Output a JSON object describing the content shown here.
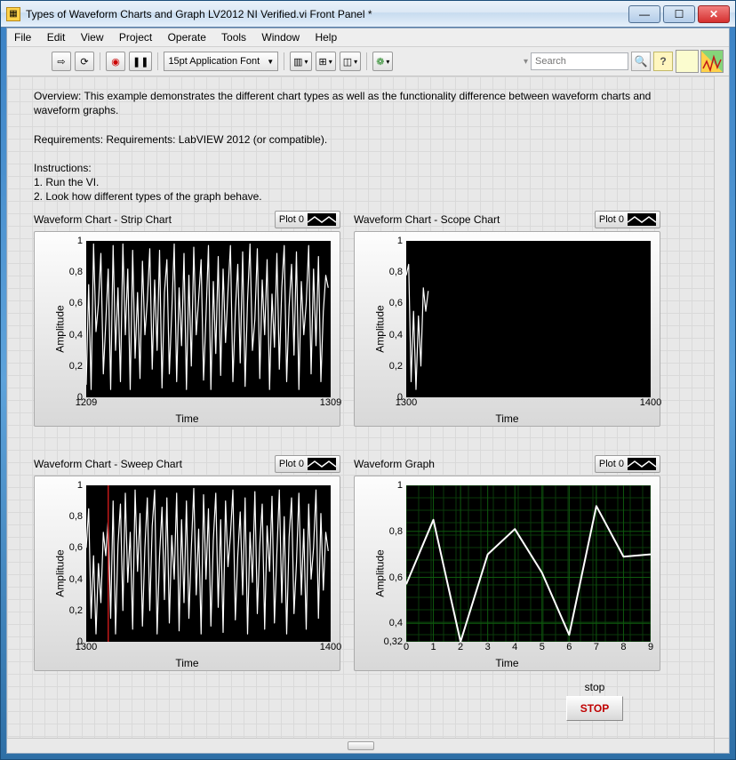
{
  "window": {
    "title": "Types of Waveform Charts and Graph LV2012 NI Verified.vi Front Panel *"
  },
  "menu": {
    "items": [
      "File",
      "Edit",
      "View",
      "Project",
      "Operate",
      "Tools",
      "Window",
      "Help"
    ]
  },
  "toolbar": {
    "font": "15pt Application Font",
    "search_placeholder": "Search"
  },
  "description": {
    "overview": "Overview: This example demonstrates the different chart types as well as the functionality difference between waveform charts and waveform graphs.",
    "requirements": "Requirements: Requirements: LabVIEW 2012 (or compatible).",
    "instructions_header": "Instructions:",
    "instruction1": "1. Run the VI.",
    "instruction2": "2. Look how different types of the graph behave."
  },
  "stop": {
    "label": "stop",
    "button": "STOP"
  },
  "chart_data": [
    {
      "id": "strip",
      "title": "Waveform Chart - Strip Chart",
      "legend": "Plot 0",
      "type": "line",
      "xlabel": "Time",
      "ylabel": "Amplitude",
      "yticks": [
        0,
        0.2,
        0.4,
        0.6,
        0.8,
        1
      ],
      "ytick_labels": [
        "0",
        "0,2",
        "0,4",
        "0,6",
        "0,8",
        "1"
      ],
      "xticks": [
        1209,
        1309
      ],
      "xtick_labels": [
        "1209",
        "1309"
      ],
      "xlim": [
        1209,
        1309
      ],
      "ylim": [
        0,
        1
      ],
      "grid": false,
      "stroke": "#ffffff",
      "series": [
        {
          "name": "Plot 0",
          "x_start": 1209,
          "x_step": 1,
          "values": [
            0.08,
            0.72,
            0.05,
            0.98,
            0.42,
            0.6,
            0.92,
            0.15,
            0.48,
            0.82,
            0.05,
            0.97,
            0.3,
            0.7,
            0.1,
            0.98,
            0.4,
            0.82,
            0.05,
            0.94,
            0.25,
            0.67,
            0.12,
            0.87,
            0.4,
            0.62,
            0.95,
            0.18,
            0.75,
            0.3,
            0.94,
            0.06,
            0.67,
            0.88,
            0.15,
            0.55,
            0.98,
            0.1,
            0.7,
            0.33,
            0.92,
            0.05,
            0.78,
            0.2,
            0.96,
            0.4,
            0.63,
            0.88,
            0.11,
            0.52,
            0.97,
            0.05,
            0.74,
            0.28,
            0.9,
            0.14,
            0.82,
            0.35,
            0.68,
            0.97,
            0.1,
            0.55,
            0.85,
            0.22,
            0.93,
            0.07,
            0.62,
            0.98,
            0.3,
            0.5,
            0.95,
            0.12,
            0.75,
            0.4,
            0.88,
            0.05,
            0.66,
            0.32,
            0.92,
            0.18,
            0.7,
            0.97,
            0.1,
            0.58,
            0.85,
            0.27,
            0.93,
            0.05,
            0.74,
            0.4,
            0.6,
            0.97,
            0.15,
            0.82,
            0.33,
            0.9,
            0.1,
            0.55,
            0.78,
            0.7
          ]
        }
      ]
    },
    {
      "id": "scope",
      "title": "Waveform Chart - Scope Chart",
      "legend": "Plot 0",
      "type": "line",
      "xlabel": "Time",
      "ylabel": "Amplitude",
      "yticks": [
        0,
        0.2,
        0.4,
        0.6,
        0.8,
        1
      ],
      "ytick_labels": [
        "0",
        "0,2",
        "0,4",
        "0,6",
        "0,8",
        "1"
      ],
      "xticks": [
        1300,
        1400
      ],
      "xtick_labels": [
        "1300",
        "1400"
      ],
      "xlim": [
        1300,
        1400
      ],
      "ylim": [
        0,
        1
      ],
      "grid": false,
      "stroke": "#ffffff",
      "series": [
        {
          "name": "Plot 0",
          "x_start": 1300,
          "x": [
            1300,
            1301,
            1302,
            1303,
            1304,
            1305,
            1306,
            1307,
            1308,
            1309
          ],
          "values": [
            0.78,
            0.85,
            0.1,
            0.55,
            0.05,
            0.52,
            0.2,
            0.7,
            0.55,
            0.68
          ]
        }
      ]
    },
    {
      "id": "sweep",
      "title": "Waveform Chart - Sweep Chart",
      "legend": "Plot 0",
      "type": "line",
      "xlabel": "Time",
      "ylabel": "Amplitude",
      "yticks": [
        0,
        0.2,
        0.4,
        0.6,
        0.8,
        1
      ],
      "ytick_labels": [
        "0",
        "0,2",
        "0,4",
        "0,6",
        "0,8",
        "1"
      ],
      "xticks": [
        1300,
        1400
      ],
      "xtick_labels": [
        "1300",
        "1400"
      ],
      "xlim": [
        1300,
        1400
      ],
      "ylim": [
        0,
        1
      ],
      "grid": false,
      "stroke": "#ffffff",
      "sweep_marker_x": 1309,
      "series": [
        {
          "name": "Plot 0",
          "x_start": 1300,
          "x_step": 1,
          "values": [
            0.6,
            0.85,
            0.15,
            0.55,
            0.05,
            0.5,
            0.25,
            0.7,
            0.55,
            0.78,
            0.15,
            0.9,
            0.05,
            0.62,
            0.88,
            0.2,
            0.95,
            0.38,
            0.7,
            0.08,
            0.97,
            0.45,
            0.82,
            0.1,
            0.6,
            0.92,
            0.2,
            0.74,
            0.97,
            0.05,
            0.55,
            0.86,
            0.27,
            0.92,
            0.12,
            0.68,
            0.4,
            0.95,
            0.07,
            0.78,
            0.25,
            0.9,
            0.15,
            0.6,
            0.98,
            0.3,
            0.72,
            0.05,
            0.94,
            0.4,
            0.85,
            0.1,
            0.65,
            0.95,
            0.22,
            0.78,
            0.06,
            0.9,
            0.48,
            0.68,
            0.97,
            0.14,
            0.55,
            0.83,
            0.3,
            0.92,
            0.05,
            0.7,
            0.38,
            0.96,
            0.18,
            0.62,
            0.88,
            0.08,
            0.74,
            0.45,
            0.93,
            0.12,
            0.57,
            0.97,
            0.25,
            0.8,
            0.05,
            0.67,
            0.92,
            0.18,
            0.5,
            0.95,
            0.3,
            0.72,
            0.08,
            0.88,
            0.4,
            0.6,
            0.97,
            0.15,
            0.82,
            0.33,
            0.7,
            0.58
          ]
        }
      ]
    },
    {
      "id": "graph",
      "title": "Waveform Graph",
      "legend": "Plot 0",
      "type": "line",
      "xlabel": "Time",
      "ylabel": "Amplitude",
      "yticks": [
        0.32,
        0.4,
        0.6,
        0.8,
        1
      ],
      "ytick_labels": [
        "0,32",
        "0,4",
        "0,6",
        "0,8",
        "1"
      ],
      "xticks": [
        0,
        1,
        2,
        3,
        4,
        5,
        6,
        7,
        8,
        9
      ],
      "xtick_labels": [
        "0",
        "1",
        "2",
        "3",
        "4",
        "5",
        "6",
        "7",
        "8",
        "9"
      ],
      "xlim": [
        0,
        9
      ],
      "ylim": [
        0.32,
        1
      ],
      "grid": true,
      "stroke": "#ffffff",
      "series": [
        {
          "name": "Plot 0",
          "x": [
            0,
            1,
            2,
            3,
            4,
            5,
            6,
            7,
            8,
            9
          ],
          "values": [
            0.57,
            0.85,
            0.32,
            0.7,
            0.81,
            0.62,
            0.35,
            0.91,
            0.69,
            0.7
          ]
        }
      ]
    }
  ]
}
